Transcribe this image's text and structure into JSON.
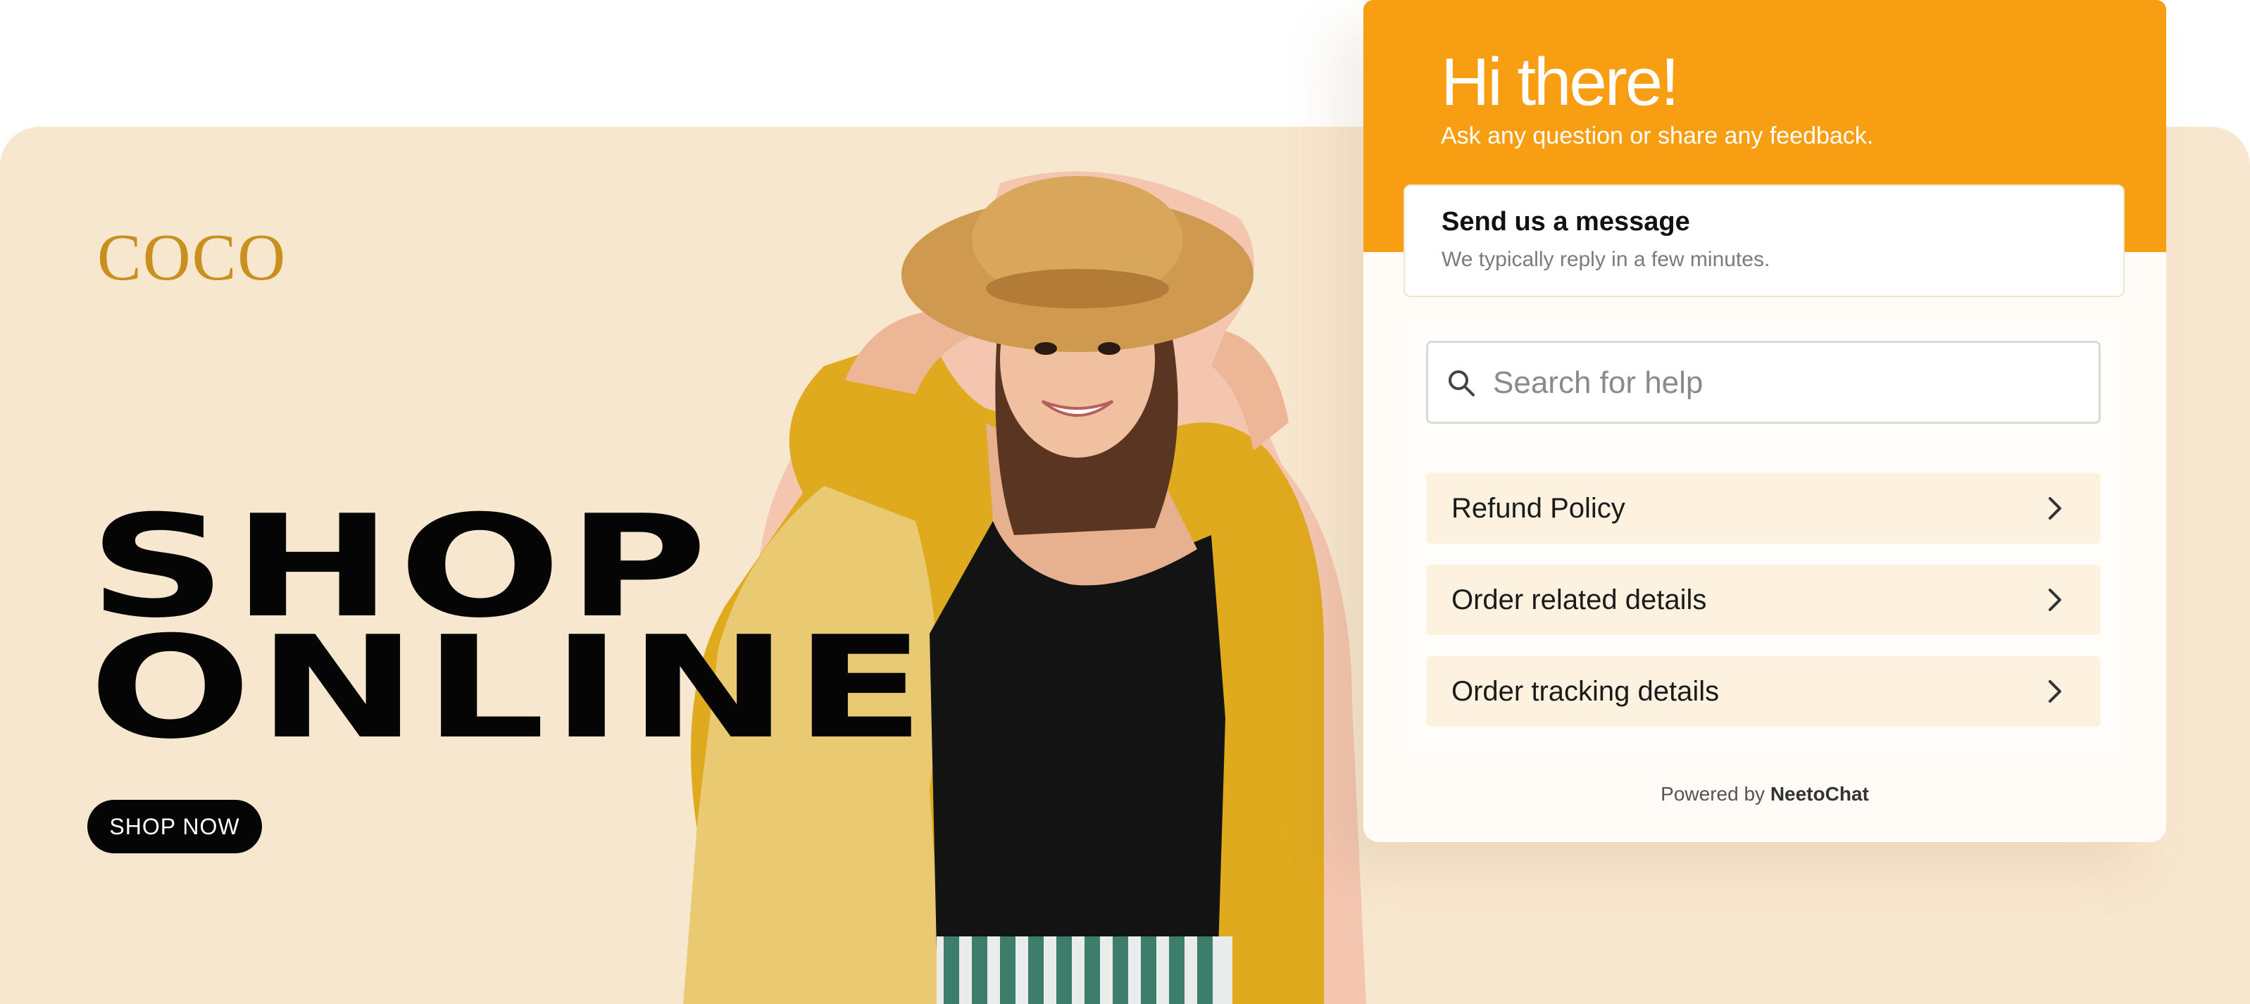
{
  "brand": {
    "logo_text": "COCO"
  },
  "hero": {
    "headline_line1": "SHOP",
    "headline_line2": "ONLINE",
    "cta_label": "SHOP NOW"
  },
  "chat_widget": {
    "greeting": "Hi there!",
    "greeting_sub": "Ask any question or share any feedback.",
    "message_card": {
      "title": "Send us a message",
      "subtitle": "We typically reply in a few minutes."
    },
    "search": {
      "placeholder": "Search for help"
    },
    "faq_items": [
      {
        "label": "Refund Policy"
      },
      {
        "label": "Order related details"
      },
      {
        "label": "Order tracking details"
      }
    ],
    "footer": {
      "powered_prefix": "Powered by",
      "powered_brand": "NeetoChat"
    }
  },
  "colors": {
    "hero_background": "#f8e7cf",
    "widget_accent": "#f89e13",
    "logo": "#c8901e",
    "cta_background": "#050505"
  },
  "icons": [
    "search-icon",
    "chevron-right-icon"
  ]
}
